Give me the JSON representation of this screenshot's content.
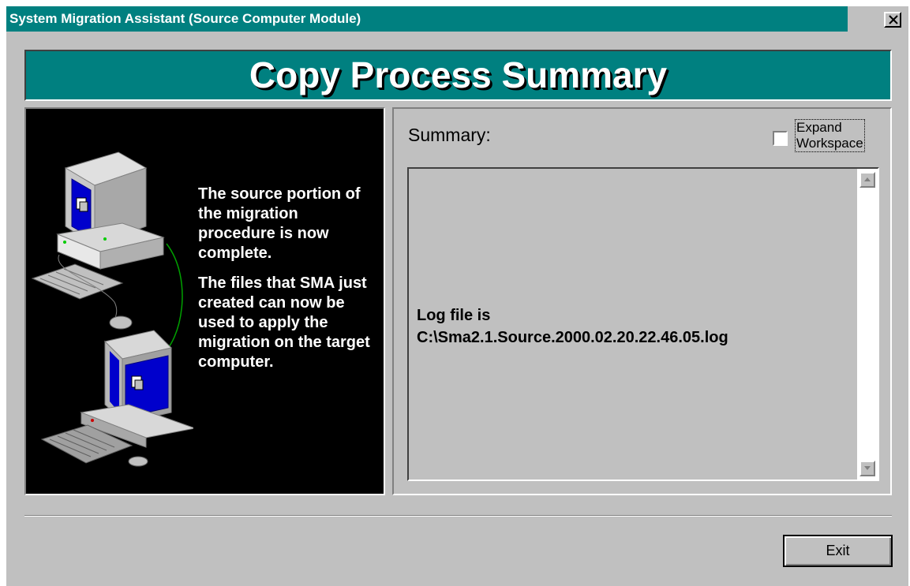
{
  "window": {
    "title": "System Migration Assistant (Source Computer Module)",
    "close_label": "×"
  },
  "banner": {
    "title": "Copy Process Summary"
  },
  "left_panel": {
    "message_1": "The source portion of the migration procedure is now complete.",
    "message_2": "The files that SMA just created can now be used to apply the migration on the target computer."
  },
  "summary": {
    "label": "Summary:",
    "expand_checkbox_checked": false,
    "expand_label_line1": "Expand",
    "expand_label_line2": "Workspace",
    "log_line1": "Log file is",
    "log_line2": "C:\\Sma2.1.Source.2000.02.20.22.46.05.log"
  },
  "footer": {
    "exit_label": "Exit"
  },
  "colors": {
    "title_bar": "#008080",
    "banner": "#008080",
    "face": "#c0c0c0",
    "illustration_bg": "#000000"
  }
}
